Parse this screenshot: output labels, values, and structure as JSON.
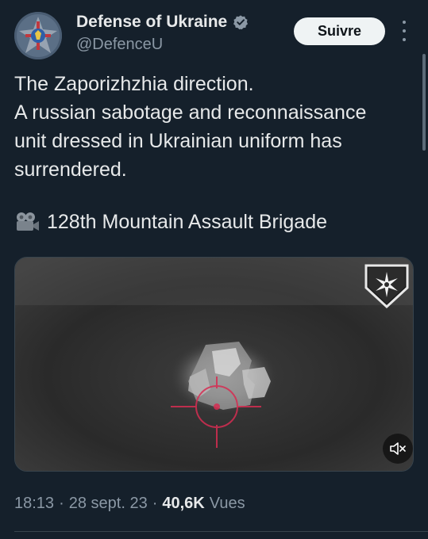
{
  "header": {
    "display_name": "Defense of Ukraine",
    "handle": "@DefenceU",
    "follow_label": "Suivre",
    "verified_color": "#8b98a5"
  },
  "tweet": {
    "lines": [
      "The Zaporizhzhia direction.",
      "A russian sabotage and reconnaissance",
      "unit dressed in Ukrainian uniform has",
      "surrendered."
    ],
    "brigade_text": "128th Mountain Assault Brigade",
    "brigade_icon": "movie-camera-icon"
  },
  "media": {
    "type": "video",
    "mute_icon": "speaker-muted-icon",
    "overlay_emblem": "brigade-emblem-icon",
    "reticle_color": "#d62d52"
  },
  "meta": {
    "time": "18:13",
    "date": "28 sept. 23",
    "views_count": "40,6K",
    "views_label": "Vues"
  },
  "colors": {
    "background": "#15202b",
    "text_primary": "#e7e9ea",
    "text_secondary": "#8b98a5",
    "button_bg": "#eff3f4"
  }
}
